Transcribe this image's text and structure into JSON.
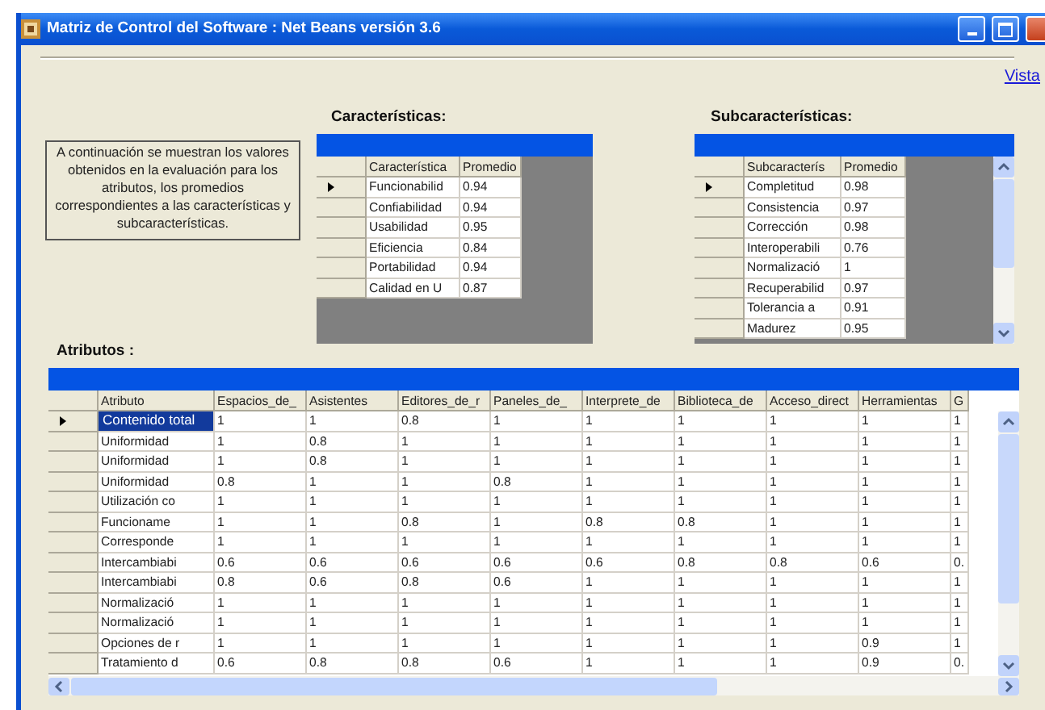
{
  "window": {
    "title": "Matriz de Control del Software : Net Beans versión 3.6"
  },
  "link": "Vista",
  "info": "A continuación se muestran los valores obtenidos en la evaluación para los atributos, los promedios correspondientes a las características y subcaracterísticas.",
  "characteristics": {
    "label": "Características:",
    "columns": [
      "Característica",
      "Promedio"
    ],
    "rows": [
      {
        "current": true,
        "cells": [
          "Funcionabilid",
          "0.94"
        ]
      },
      {
        "current": false,
        "cells": [
          "Confiabilidad",
          "0.94"
        ]
      },
      {
        "current": false,
        "cells": [
          "Usabilidad",
          "0.95"
        ]
      },
      {
        "current": false,
        "cells": [
          "Eficiencia",
          "0.84"
        ]
      },
      {
        "current": false,
        "cells": [
          "Portabilidad",
          "0.94"
        ]
      },
      {
        "current": false,
        "cells": [
          "Calidad en U",
          "0.87"
        ]
      }
    ]
  },
  "subcharacteristics": {
    "label": "Subcaracterísticas:",
    "columns": [
      "Subcaracterís",
      "Promedio"
    ],
    "rows": [
      {
        "current": true,
        "cells": [
          "Completitud",
          "0.98"
        ]
      },
      {
        "current": false,
        "cells": [
          "Consistencia",
          "0.97"
        ]
      },
      {
        "current": false,
        "cells": [
          "Corrección",
          "0.98"
        ]
      },
      {
        "current": false,
        "cells": [
          "Interoperabili",
          "0.76"
        ]
      },
      {
        "current": false,
        "cells": [
          "Normalizació",
          "1"
        ]
      },
      {
        "current": false,
        "cells": [
          "Recuperabilid",
          "0.97"
        ]
      },
      {
        "current": false,
        "cells": [
          "Tolerancia a",
          "0.91"
        ]
      },
      {
        "current": false,
        "cells": [
          "Madurez",
          "0.95"
        ]
      }
    ]
  },
  "attributes": {
    "label": "Atributos :",
    "columns": [
      "Atributo",
      "Espacios_de_",
      "Asistentes",
      "Editores_de_r",
      "Paneles_de_",
      "Interprete_de",
      "Biblioteca_de",
      "Acceso_direct",
      "Herramientas",
      "G"
    ],
    "rows": [
      {
        "current": true,
        "attribute_selected": true,
        "cells": [
          "Contenido total",
          "1",
          "1",
          "0.8",
          "1",
          "1",
          "1",
          "1",
          "1",
          "1"
        ]
      },
      {
        "current": false,
        "attribute_selected": false,
        "cells": [
          "Uniformidad",
          "1",
          "0.8",
          "1",
          "1",
          "1",
          "1",
          "1",
          "1",
          "1"
        ]
      },
      {
        "current": false,
        "attribute_selected": false,
        "cells": [
          "Uniformidad",
          "1",
          "0.8",
          "1",
          "1",
          "1",
          "1",
          "1",
          "1",
          "1"
        ]
      },
      {
        "current": false,
        "attribute_selected": false,
        "cells": [
          "Uniformidad",
          "0.8",
          "1",
          "1",
          "0.8",
          "1",
          "1",
          "1",
          "1",
          "1"
        ]
      },
      {
        "current": false,
        "attribute_selected": false,
        "cells": [
          "Utilización co",
          "1",
          "1",
          "1",
          "1",
          "1",
          "1",
          "1",
          "1",
          "1"
        ]
      },
      {
        "current": false,
        "attribute_selected": false,
        "cells": [
          "Funcioname",
          "1",
          "1",
          "0.8",
          "1",
          "0.8",
          "0.8",
          "1",
          "1",
          "1"
        ]
      },
      {
        "current": false,
        "attribute_selected": false,
        "cells": [
          "Corresponde",
          "1",
          "1",
          "1",
          "1",
          "1",
          "1",
          "1",
          "1",
          "1"
        ]
      },
      {
        "current": false,
        "attribute_selected": false,
        "cells": [
          "Intercambiabi",
          "0.6",
          "0.6",
          "0.6",
          "0.6",
          "0.6",
          "0.8",
          "0.8",
          "0.6",
          "0."
        ]
      },
      {
        "current": false,
        "attribute_selected": false,
        "cells": [
          "Intercambiabi",
          "0.8",
          "0.6",
          "0.8",
          "0.6",
          "1",
          "1",
          "1",
          "1",
          "1"
        ]
      },
      {
        "current": false,
        "attribute_selected": false,
        "cells": [
          "Normalizació",
          "1",
          "1",
          "1",
          "1",
          "1",
          "1",
          "1",
          "1",
          "1"
        ]
      },
      {
        "current": false,
        "attribute_selected": false,
        "cells": [
          "Normalizació",
          "1",
          "1",
          "1",
          "1",
          "1",
          "1",
          "1",
          "1",
          "1"
        ]
      },
      {
        "current": false,
        "attribute_selected": false,
        "cells": [
          "Opciones de r",
          "1",
          "1",
          "1",
          "1",
          "1",
          "1",
          "1",
          "0.9",
          "1"
        ]
      },
      {
        "current": false,
        "attribute_selected": false,
        "cells": [
          "Tratamiento d",
          "0.6",
          "0.8",
          "0.8",
          "0.6",
          "1",
          "1",
          "1",
          "0.9",
          "0."
        ]
      }
    ]
  }
}
